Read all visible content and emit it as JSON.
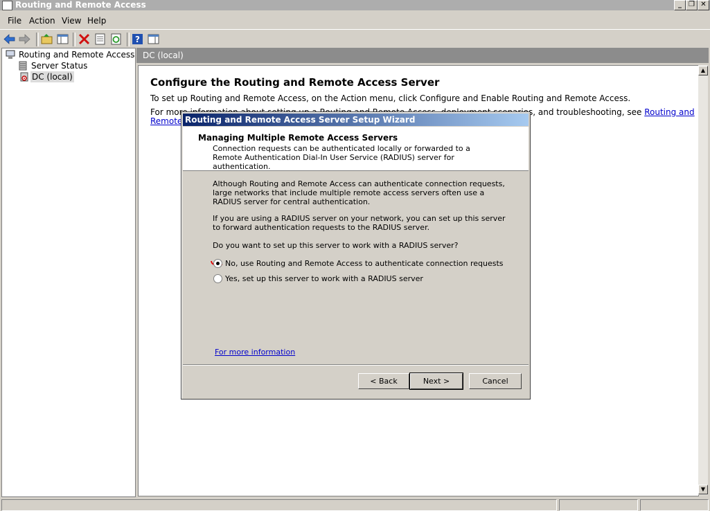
{
  "window": {
    "title": "Routing and Remote Access"
  },
  "window_buttons": {
    "minimize": "_",
    "restore": "❐",
    "close": "✕"
  },
  "menu": {
    "items": [
      "File",
      "Action",
      "View",
      "Help"
    ]
  },
  "toolbar": {
    "icons": [
      "back-arrow-icon",
      "forward-arrow-icon",
      "up-folder-icon",
      "show-hide-tree-icon",
      "delete-icon",
      "properties-icon",
      "refresh-icon",
      "help-icon",
      "show-hide-action-pane-icon"
    ]
  },
  "tree": {
    "root": "Routing and Remote Access",
    "items": [
      "Server Status",
      "DC (local)"
    ]
  },
  "pane": {
    "header": "DC (local)",
    "title": "Configure the Routing and Remote Access Server",
    "line1": "To set up Routing and Remote Access, on the Action menu, click Configure and Enable Routing and Remote Access.",
    "line2_start": "For more information about setting up a Routing and Remote Access, deployment scenarios, and troubleshooting, see",
    "link_part1": "Routing and",
    "link_part2": "Remote"
  },
  "dialog": {
    "title": "Routing and Remote Access Server Setup Wizard",
    "header_title": "Managing Multiple Remote Access Servers",
    "header_sub": "Connection requests can be authenticated locally or forwarded to a Remote Authentication Dial-In User Service (RADIUS) server for authentication.",
    "para1": "Although Routing and Remote Access can authenticate connection requests, large networks that include multiple remote access servers often use a RADIUS server for central authentication.",
    "para2": "If you are using a RADIUS server on your network, you can set up this server to forward authentication requests to the RADIUS server.",
    "question": "Do you want to set up this server to work with a RADIUS server?",
    "options": [
      {
        "label": "No, use Routing and Remote Access to authenticate connection requests",
        "selected": true
      },
      {
        "label": "Yes, set up this server to work with a RADIUS server",
        "selected": false
      }
    ],
    "more_info": "For more information",
    "buttons": {
      "back": "< Back",
      "next": "Next >",
      "cancel": "Cancel"
    }
  }
}
